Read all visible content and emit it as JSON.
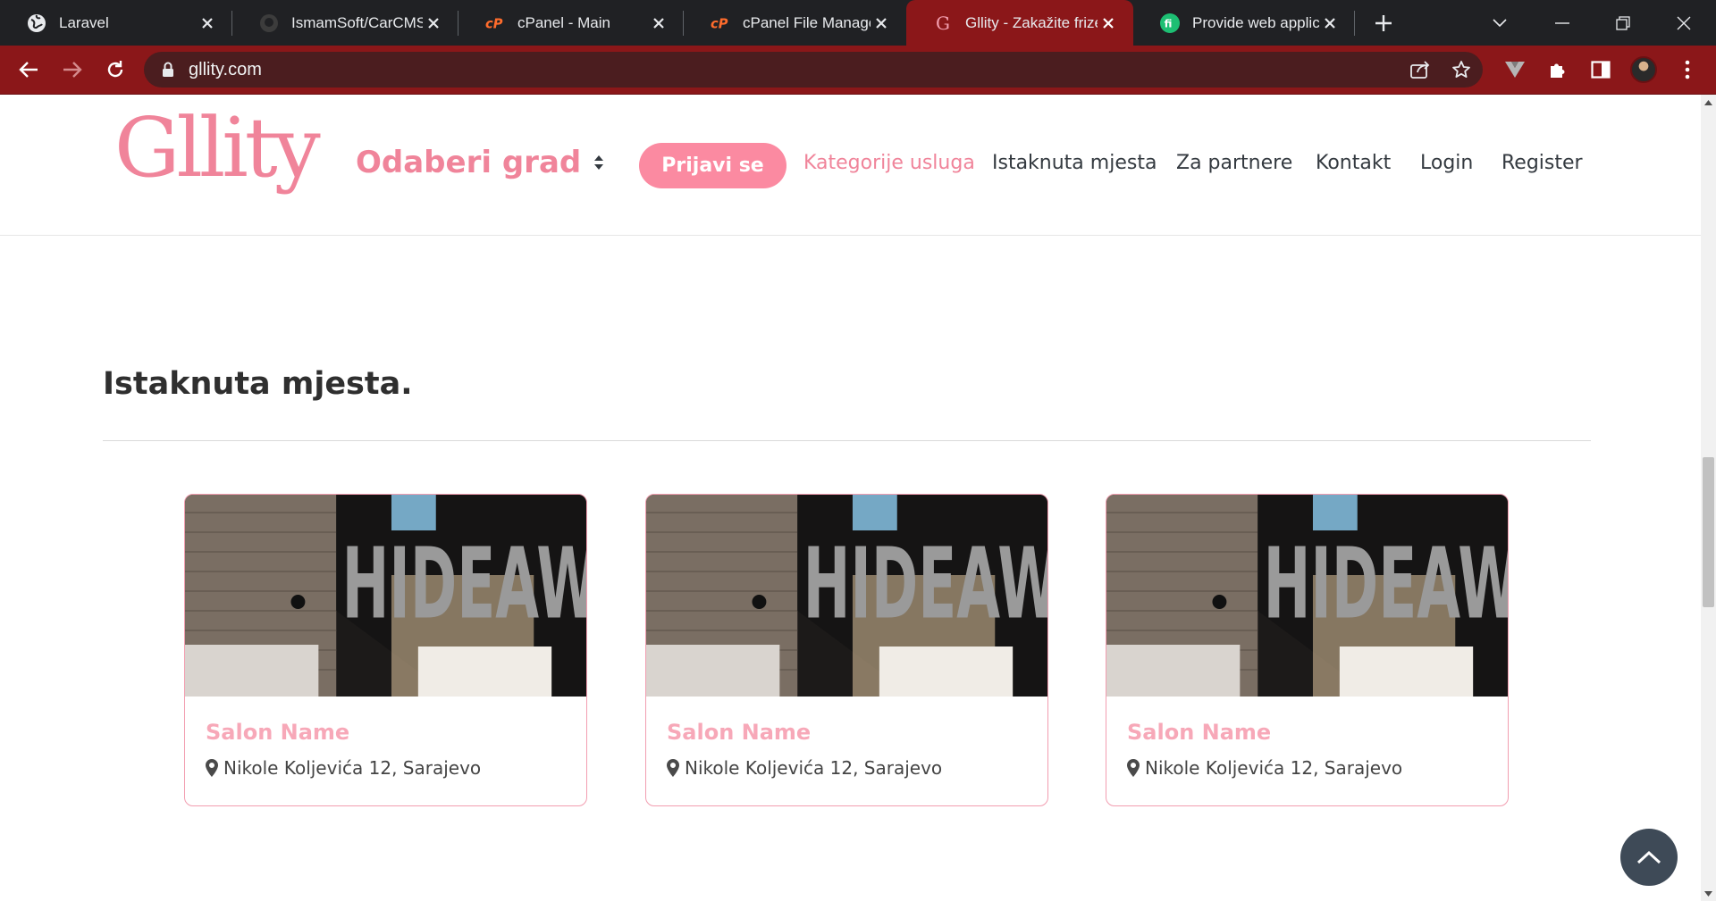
{
  "browser": {
    "tabs": [
      {
        "title": "Laravel",
        "icon": "globe-icon"
      },
      {
        "title": "IsmamSoft/CarCMS",
        "icon": "github-icon"
      },
      {
        "title": "cPanel - Main",
        "icon": "cpanel-icon"
      },
      {
        "title": "cPanel File Manager",
        "icon": "cpanel-icon"
      },
      {
        "title": "Gllity - Zakažite frizera",
        "icon": "gllity-icon",
        "active": true
      },
      {
        "title": "Provide web application",
        "icon": "fiverr-icon"
      }
    ],
    "url": "gllity.com",
    "accent_color": "#8b1719"
  },
  "header": {
    "logo": "Gllity",
    "city_select": "Odaberi grad",
    "login_button": "Prijavi se",
    "nav": {
      "categories": "Kategorije usluga",
      "featured": "Istaknuta mjesta",
      "partners": "Za partnere",
      "contact": "Kontakt",
      "login": "Login",
      "register": "Register"
    }
  },
  "section": {
    "title": "Istaknuta mjesta."
  },
  "cards": [
    {
      "name": "Salon Name",
      "address": "Nikole Koljevića 12, Sarajevo",
      "image_text": "HIDEAWAY"
    },
    {
      "name": "Salon Name",
      "address": "Nikole Koljevića 12, Sarajevo",
      "image_text": "HIDEAWAY"
    },
    {
      "name": "Salon Name",
      "address": "Nikole Koljevića 12, Sarajevo",
      "image_text": "HIDEAWAY"
    }
  ],
  "colors": {
    "brand_pink": "#f0849a",
    "button_pink": "#fb8aa1",
    "scroll_top_bg": "#3e4a57"
  }
}
